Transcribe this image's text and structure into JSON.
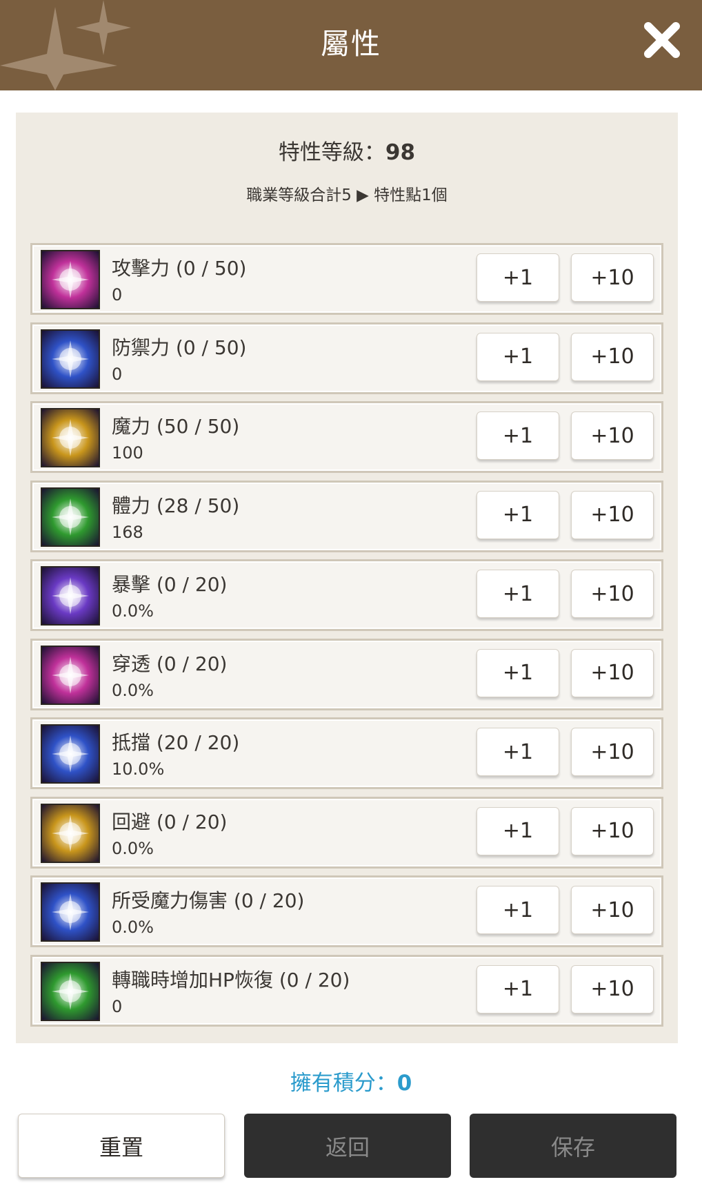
{
  "header": {
    "title": "屬性"
  },
  "summary": {
    "level_label": "特性等級：",
    "level_value": "98",
    "job_info": "職業等級合計5 ▶ 特性點1個"
  },
  "attributes": [
    {
      "name": "攻擊力 (0 / 50)",
      "value": "0",
      "icon": "sword-icon",
      "color": "#c0319a"
    },
    {
      "name": "防禦力 (0 / 50)",
      "value": "0",
      "icon": "shield-icon",
      "color": "#2f52c7"
    },
    {
      "name": "魔力 (50 / 50)",
      "value": "100",
      "icon": "magic-star-icon",
      "color": "#c9961c"
    },
    {
      "name": "體力 (28 / 50)",
      "value": "168",
      "icon": "body-armor-icon",
      "color": "#2f9a2f"
    },
    {
      "name": "暴擊 (0 / 20)",
      "value": "0.0%",
      "icon": "critical-icon",
      "color": "#6a3ac4"
    },
    {
      "name": "穿透 (0 / 20)",
      "value": "0.0%",
      "icon": "penetrate-icon",
      "color": "#c0319a"
    },
    {
      "name": "抵擋 (20 / 20)",
      "value": "10.0%",
      "icon": "block-icon",
      "color": "#2f52c7"
    },
    {
      "name": "回避 (0 / 20)",
      "value": "0.0%",
      "icon": "evade-icon",
      "color": "#c9961c"
    },
    {
      "name": "所受魔力傷害 (0 / 20)",
      "value": "0.0%",
      "icon": "magic-shield-icon",
      "color": "#2f52c7"
    },
    {
      "name": "轉職時增加HP恢復 (0 / 20)",
      "value": "0",
      "icon": "hp-recovery-icon",
      "color": "#2f9a2f"
    }
  ],
  "buttons": {
    "plus1": "+1",
    "plus10": "+10"
  },
  "points": {
    "label": "擁有積分：",
    "value": "0"
  },
  "footer": {
    "reset": "重置",
    "back": "返回",
    "save": "保存"
  },
  "colors": {
    "header": "#7a5e3f",
    "points": "#2b9bcc",
    "dark_button": "#2f2f2f"
  }
}
